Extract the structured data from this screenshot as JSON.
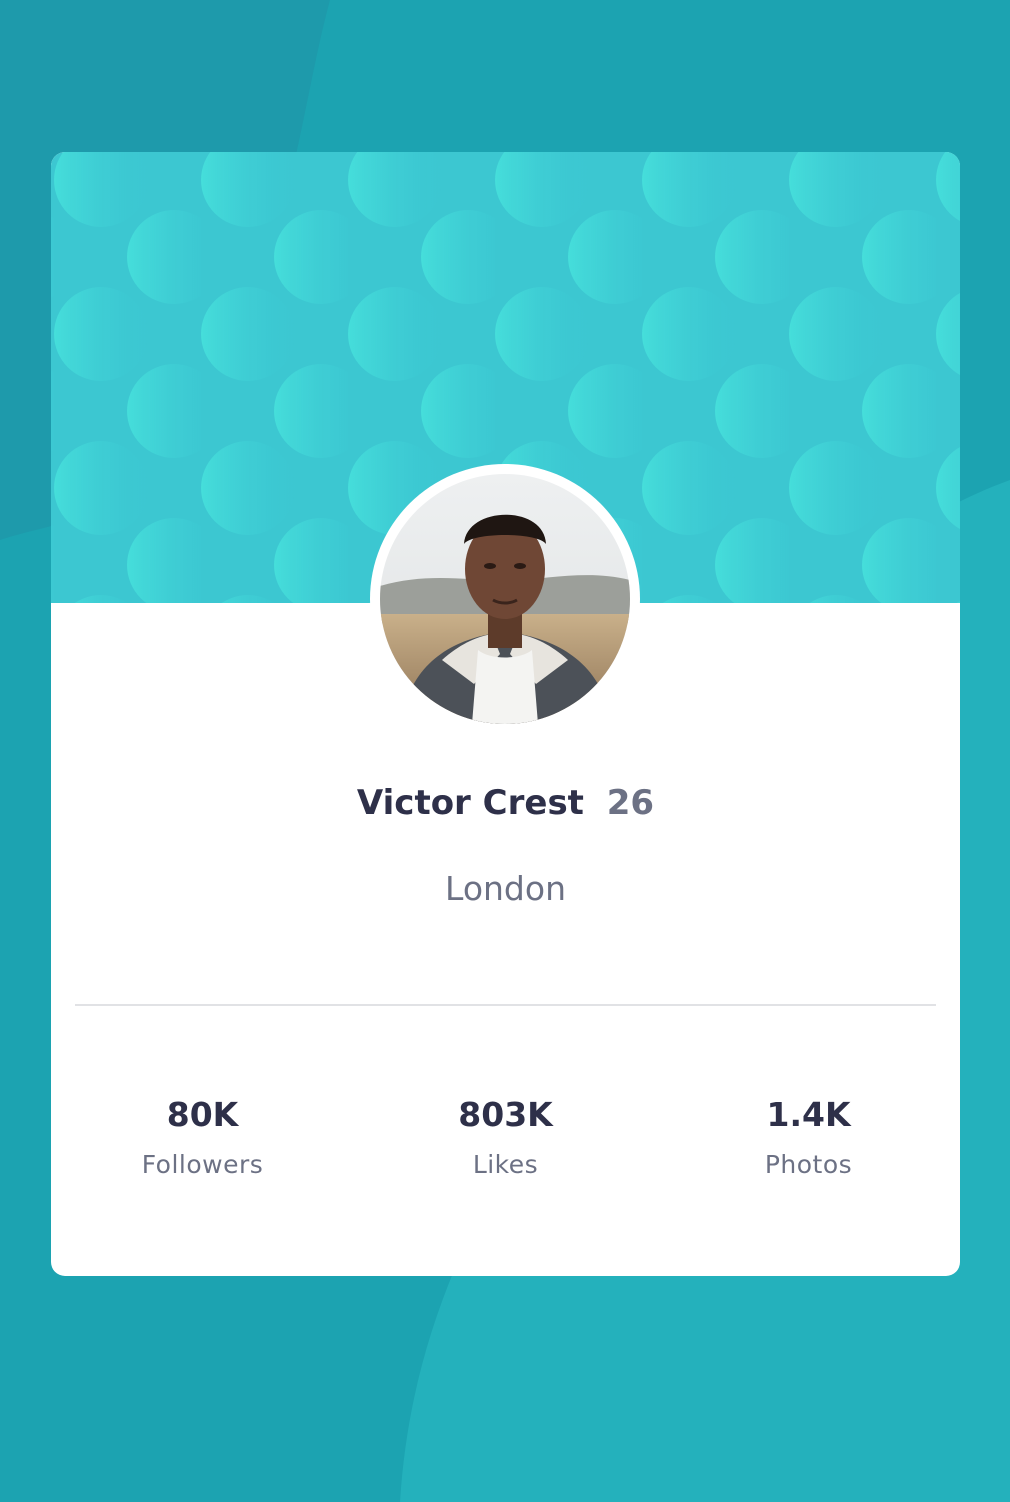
{
  "profile": {
    "name": "Victor Crest",
    "age": "26",
    "city": "London"
  },
  "stats": [
    {
      "value": "80K",
      "label": "Followers"
    },
    {
      "value": "803K",
      "label": "Likes"
    },
    {
      "value": "1.4K",
      "label": "Photos"
    }
  ],
  "colors": {
    "page_background": "#1ca3b1",
    "banner": "#3cc7d1",
    "name_text": "#2e3049",
    "muted_text": "#6c7184"
  }
}
